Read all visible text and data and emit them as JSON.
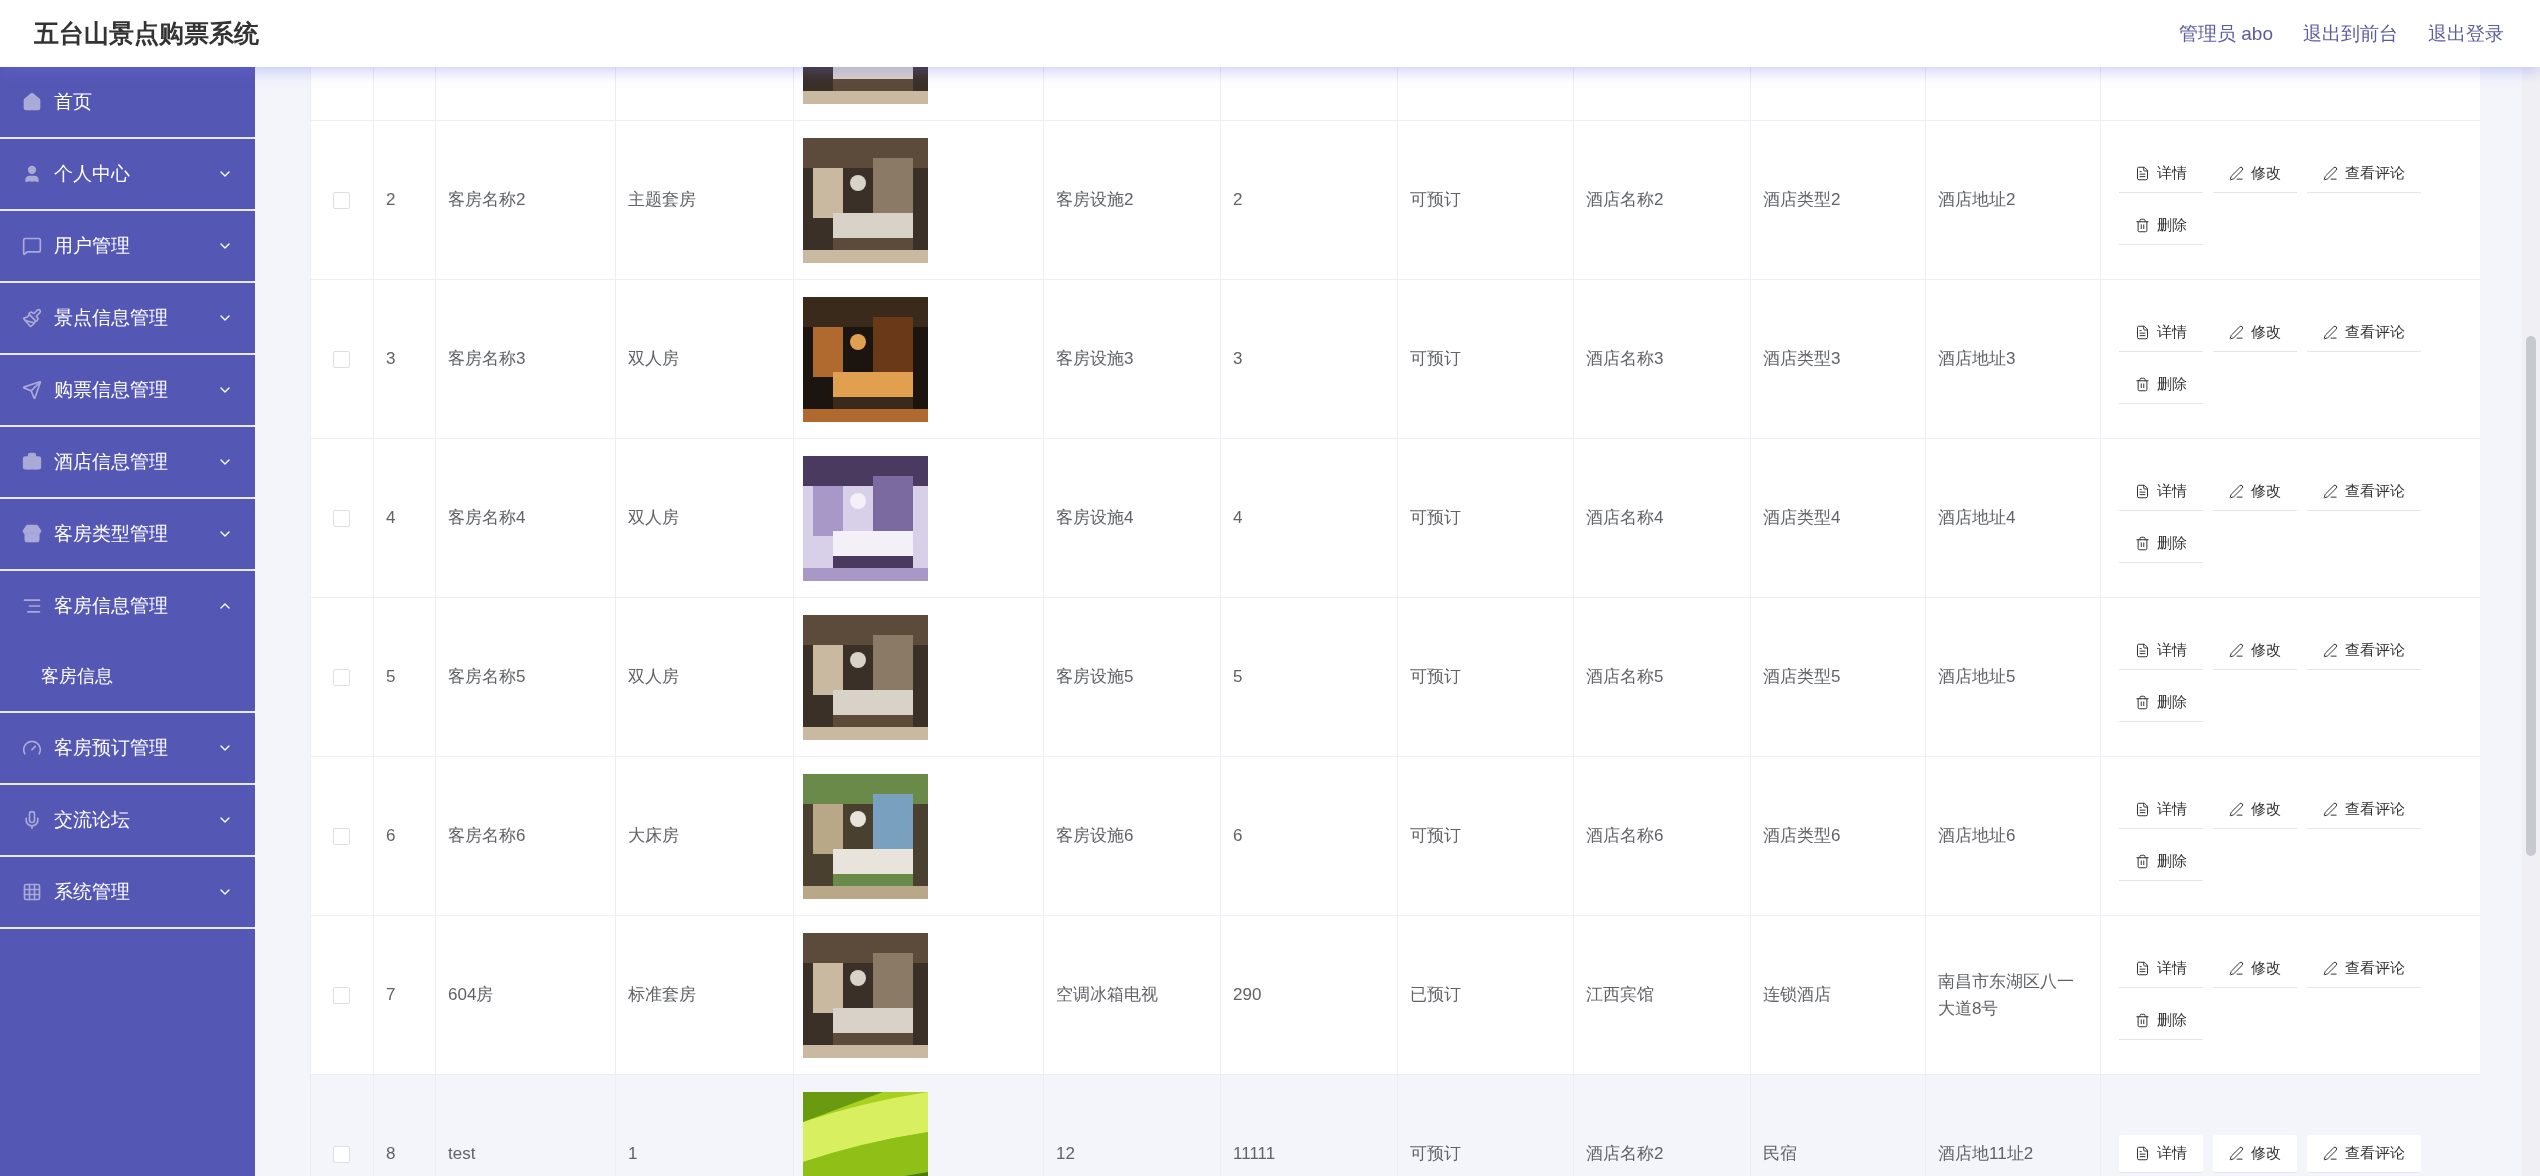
{
  "header": {
    "title": "五台山景点购票系统",
    "links": [
      "管理员 abo",
      "退出到前台",
      "退出登录"
    ]
  },
  "sidebar": {
    "items": [
      {
        "label": "首页",
        "kind": "link"
      },
      {
        "label": "个人中心",
        "kind": "menu",
        "expanded": false
      },
      {
        "label": "用户管理",
        "kind": "menu",
        "expanded": false
      },
      {
        "label": "景点信息管理",
        "kind": "menu",
        "expanded": false
      },
      {
        "label": "购票信息管理",
        "kind": "menu",
        "expanded": false
      },
      {
        "label": "酒店信息管理",
        "kind": "menu",
        "expanded": false
      },
      {
        "label": "客房类型管理",
        "kind": "menu",
        "expanded": false
      },
      {
        "label": "客房信息管理",
        "kind": "menu",
        "expanded": true,
        "children": [
          {
            "label": "客房信息"
          }
        ]
      },
      {
        "label": "客房预订管理",
        "kind": "menu",
        "expanded": false
      },
      {
        "label": "交流论坛",
        "kind": "menu",
        "expanded": false
      },
      {
        "label": "系统管理",
        "kind": "menu",
        "expanded": false
      }
    ]
  },
  "table": {
    "rows": [
      {
        "kind": "partial"
      },
      {
        "kind": "full",
        "highlighted": false,
        "checked": false,
        "index": "2",
        "name": "客房名称2",
        "type": "主题套房",
        "facilities": "客房设施2",
        "price": "2",
        "status": "可预订",
        "hotel": "酒店名称2",
        "hotel_type": "酒店类型2",
        "address": "酒店地址2",
        "actions": [
          "详情",
          "修改",
          "查看评论",
          "删除"
        ]
      },
      {
        "kind": "full",
        "highlighted": false,
        "checked": false,
        "index": "3",
        "name": "客房名称3",
        "type": "双人房",
        "facilities": "客房设施3",
        "price": "3",
        "status": "可预订",
        "hotel": "酒店名称3",
        "hotel_type": "酒店类型3",
        "address": "酒店地址3",
        "actions": [
          "详情",
          "修改",
          "查看评论",
          "删除"
        ]
      },
      {
        "kind": "full",
        "highlighted": false,
        "checked": false,
        "index": "4",
        "name": "客房名称4",
        "type": "双人房",
        "facilities": "客房设施4",
        "price": "4",
        "status": "可预订",
        "hotel": "酒店名称4",
        "hotel_type": "酒店类型4",
        "address": "酒店地址4",
        "actions": [
          "详情",
          "修改",
          "查看评论",
          "删除"
        ]
      },
      {
        "kind": "full",
        "highlighted": false,
        "checked": false,
        "index": "5",
        "name": "客房名称5",
        "type": "双人房",
        "facilities": "客房设施5",
        "price": "5",
        "status": "可预订",
        "hotel": "酒店名称5",
        "hotel_type": "酒店类型5",
        "address": "酒店地址5",
        "actions": [
          "详情",
          "修改",
          "查看评论",
          "删除"
        ]
      },
      {
        "kind": "full",
        "highlighted": false,
        "checked": false,
        "index": "6",
        "name": "客房名称6",
        "type": "大床房",
        "facilities": "客房设施6",
        "price": "6",
        "status": "可预订",
        "hotel": "酒店名称6",
        "hotel_type": "酒店类型6",
        "address": "酒店地址6",
        "actions": [
          "详情",
          "修改",
          "查看评论",
          "删除"
        ]
      },
      {
        "kind": "full",
        "highlighted": false,
        "checked": false,
        "index": "7",
        "name": "604房",
        "type": "标准套房",
        "facilities": "空调冰箱电视",
        "price": "290",
        "status": "已预订",
        "hotel": "江西宾馆",
        "hotel_type": "连锁酒店",
        "address": "南昌市东湖区八一大道8号",
        "actions": [
          "详情",
          "修改",
          "查看评论",
          "删除"
        ]
      },
      {
        "kind": "full",
        "highlighted": true,
        "checked": false,
        "index": "8",
        "name": "test",
        "type": "1",
        "facilities": "12",
        "price": "11111",
        "status": "可预订",
        "hotel": "酒店名称2",
        "hotel_type": "民宿",
        "address": "酒店地11址2",
        "actions": [
          "详情",
          "修改",
          "查看评论"
        ]
      }
    ]
  }
}
